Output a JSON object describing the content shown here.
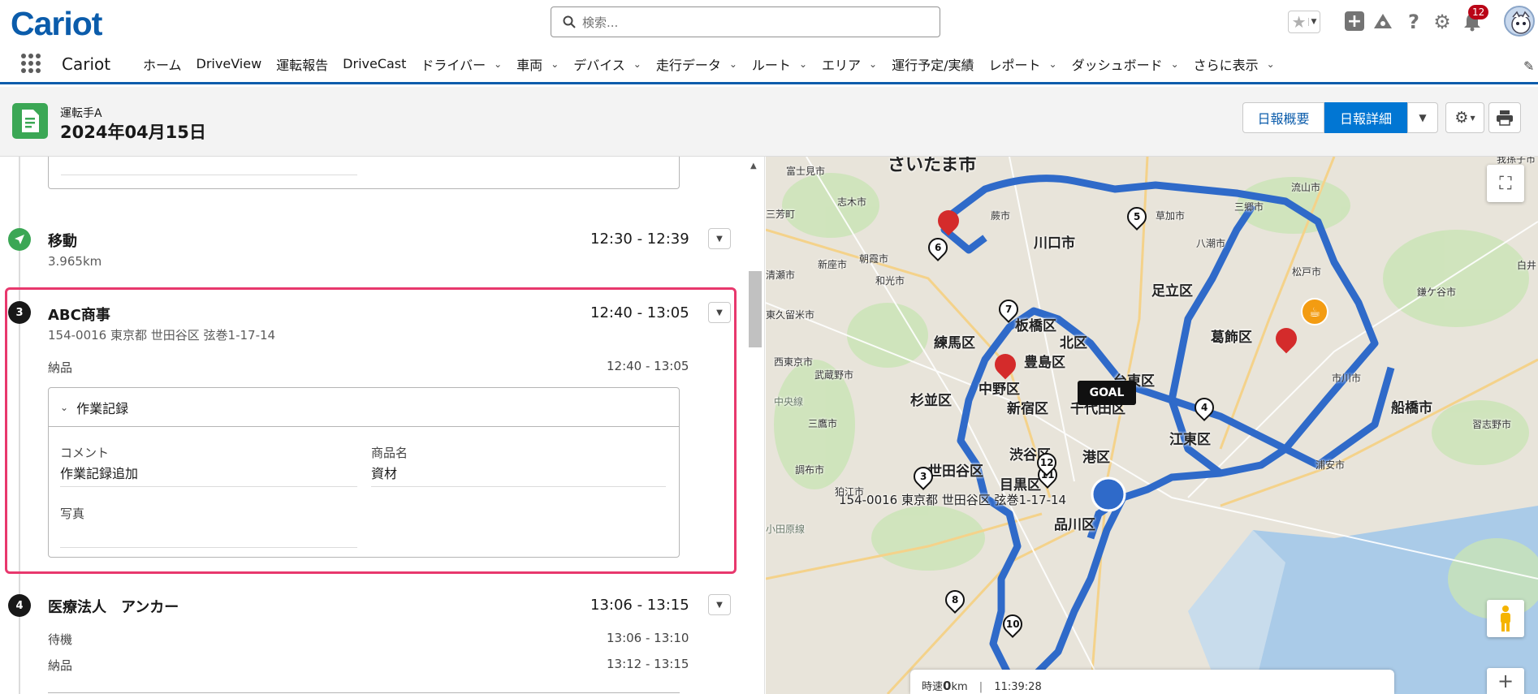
{
  "app": {
    "logo": "Cariot",
    "name": "Cariot"
  },
  "search": {
    "placeholder": "検索..."
  },
  "notifications": {
    "count": "12"
  },
  "nav": {
    "items": [
      {
        "label": "ホーム",
        "dropdown": false
      },
      {
        "label": "DriveView",
        "dropdown": false
      },
      {
        "label": "運転報告",
        "dropdown": false
      },
      {
        "label": "DriveCast",
        "dropdown": false
      },
      {
        "label": "ドライバー",
        "dropdown": true
      },
      {
        "label": "車両",
        "dropdown": true
      },
      {
        "label": "デバイス",
        "dropdown": true
      },
      {
        "label": "走行データ",
        "dropdown": true
      },
      {
        "label": "ルート",
        "dropdown": true
      },
      {
        "label": "エリア",
        "dropdown": true
      },
      {
        "label": "運行予定/実績",
        "dropdown": false
      },
      {
        "label": "レポート",
        "dropdown": true
      },
      {
        "label": "ダッシュボード",
        "dropdown": true
      },
      {
        "label": "さらに表示",
        "dropdown": true
      }
    ]
  },
  "header": {
    "subtitle": "運転手A",
    "title": "2024年04月15日",
    "btn_summary": "日報概要",
    "btn_detail": "日報詳細"
  },
  "timeline": {
    "move": {
      "title": "移動",
      "time": "12:30 - 12:39",
      "distance": "3.965km"
    },
    "stop3": {
      "number": "3",
      "title": "ABC商事",
      "time": "12:40 - 13:05",
      "address": "154-0016 東京都 世田谷区 弦巻1-17-14",
      "task_label": "納品",
      "task_time": "12:40 - 13:05",
      "record": {
        "header": "作業記録",
        "comment_label": "コメント",
        "comment_value": "作業記録追加",
        "product_label": "商品名",
        "product_value": "資材",
        "photo_label": "写真"
      }
    },
    "stop4": {
      "number": "4",
      "title": "医療法人　アンカー",
      "time": "13:06 - 13:15",
      "tasks": [
        {
          "label": "待機",
          "time": "13:06 - 13:10"
        },
        {
          "label": "納品",
          "time": "13:12 - 13:15"
        }
      ]
    }
  },
  "map": {
    "labels": {
      "kawaguchi": "川口市",
      "adachi": "足立区",
      "itabashi": "板橋区",
      "kita": "北区",
      "nerima": "練馬区",
      "toshima": "豊島区",
      "katsushika": "葛飾区",
      "taito": "台東区",
      "nakano": "中野区",
      "suginami": "杉並区",
      "shinjuku": "新宿区",
      "chiyoda": "千代田区",
      "koto": "江東区",
      "shibuya": "渋谷区",
      "setagaya": "世田谷区",
      "meguro": "目黒区",
      "shinagawa": "品川区",
      "minato": "港区",
      "funabashi": "船橋市",
      "goal": "GOAL",
      "address": "154-0016 東京都 世田谷区 弦巻1-17-14",
      "saitama": "さいたま市",
      "fujimi": "富士見市",
      "shiki": "志木市",
      "miyoshi": "三芳町",
      "asaka": "朝霞市",
      "niiza": "新座市",
      "wako": "和光市",
      "kiyose": "清瀬市",
      "higashikurume": "東久留米市",
      "nishitokyo": "西東京市",
      "musashino": "武蔵野市",
      "mitaka": "三鷹市",
      "chofu": "調布市",
      "komae": "狛江市",
      "warabi": "蕨市",
      "soka": "草加市",
      "yashio": "八潮市",
      "misato": "三郷市",
      "nagareyama": "流山市",
      "matsudo": "松戸市",
      "ichikawa": "市川市",
      "kamagaya": "鎌ケ谷市",
      "narashino": "習志野市",
      "urayasu": "浦安市",
      "abiko": "我孫子市",
      "shiroi": "白井",
      "chuo_line": "中央線",
      "odakyu": "小田原線"
    },
    "speed": {
      "prefix": "時速",
      "value": "0",
      "unit": "km",
      "sep": "|",
      "time": "11:39:28"
    },
    "pins": [
      "3",
      "4",
      "5",
      "6",
      "7",
      "8",
      "10",
      "11",
      "12"
    ]
  }
}
